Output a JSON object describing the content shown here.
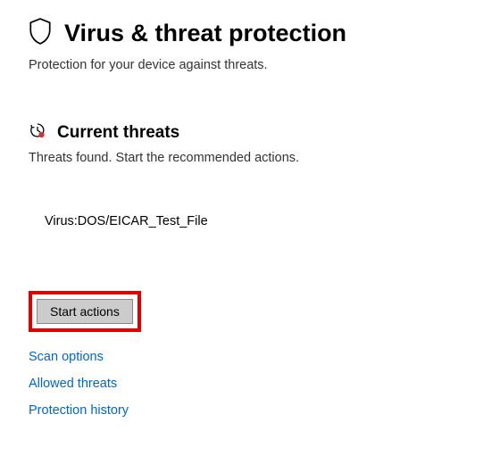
{
  "header": {
    "title": "Virus & threat protection",
    "subtitle": "Protection for your device against threats."
  },
  "current_threats": {
    "title": "Current threats",
    "subtitle": "Threats found. Start the recommended actions.",
    "threat_name": "Virus:DOS/EICAR_Test_File"
  },
  "actions": {
    "start_button": "Start actions"
  },
  "links": {
    "scan_options": "Scan options",
    "allowed_threats": "Allowed threats",
    "protection_history": "Protection history"
  }
}
